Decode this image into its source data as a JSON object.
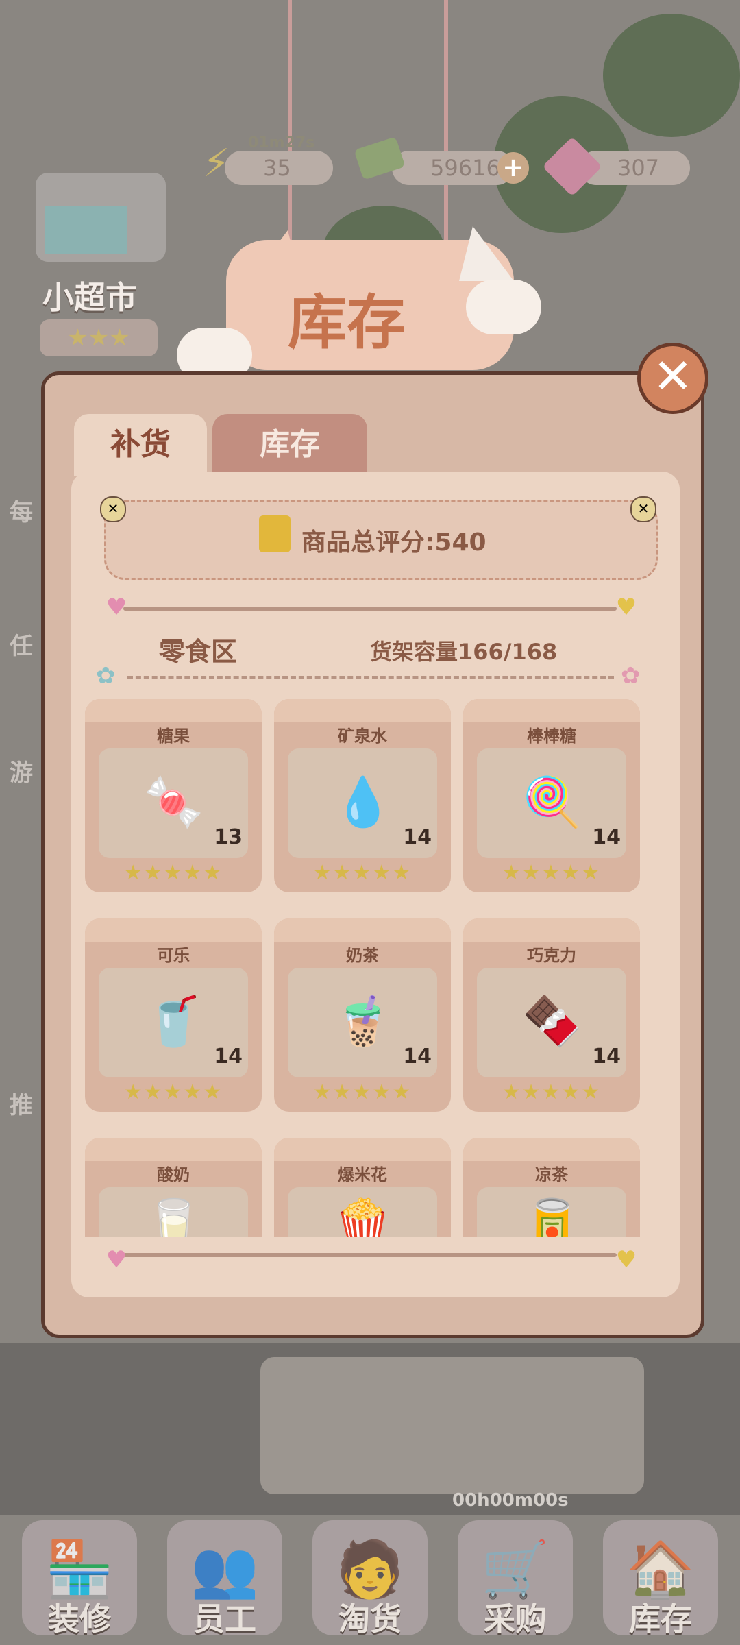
{
  "top_bar": {
    "energy_value": "35",
    "energy_timer": "01m27s",
    "cash_value": "59616",
    "gems_value": "307",
    "plus_symbol": "+"
  },
  "store": {
    "name": "小超市",
    "stars": "★★★"
  },
  "panel": {
    "title": "库存",
    "tabs": [
      {
        "label": "补货",
        "active": true
      },
      {
        "label": "库存",
        "active": false
      }
    ],
    "score_label": "商品总评分:540",
    "zone_name": "零食区",
    "shelf_capacity": "货架容量166/168",
    "close_symbol": "✕"
  },
  "items": [
    {
      "name": "糖果",
      "count": "13",
      "stars": "★★★★★",
      "icon": "candy-icon",
      "glyph": "🍬"
    },
    {
      "name": "矿泉水",
      "count": "14",
      "stars": "★★★★★",
      "icon": "water-bottle-icon",
      "glyph": "💧"
    },
    {
      "name": "棒棒糖",
      "count": "14",
      "stars": "★★★★★",
      "icon": "lollipop-icon",
      "glyph": "🍭"
    },
    {
      "name": "可乐",
      "count": "14",
      "stars": "★★★★★",
      "icon": "cola-bottle-icon",
      "glyph": "🥤"
    },
    {
      "name": "奶茶",
      "count": "14",
      "stars": "★★★★★",
      "icon": "milk-tea-icon",
      "glyph": "🧋"
    },
    {
      "name": "巧克力",
      "count": "14",
      "stars": "★★★★★",
      "icon": "chocolate-icon",
      "glyph": "🍫"
    },
    {
      "name": "酸奶",
      "count": "",
      "stars": "",
      "icon": "yogurt-icon",
      "glyph": "🥛"
    },
    {
      "name": "爆米花",
      "count": "",
      "stars": "",
      "icon": "popcorn-icon",
      "glyph": "🍿"
    },
    {
      "name": "凉茶",
      "count": "",
      "stars": "",
      "icon": "herbal-tea-can-icon",
      "glyph": "🥫"
    }
  ],
  "bottom_nav": {
    "timer": "00h00m00s",
    "items": [
      {
        "label": "装修",
        "icon": "decorate-icon",
        "glyph": "🏪"
      },
      {
        "label": "员工",
        "icon": "staff-icon",
        "glyph": "👥"
      },
      {
        "label": "淘货",
        "icon": "sourcing-icon",
        "glyph": "🧑"
      },
      {
        "label": "采购",
        "icon": "shopping-cart-icon",
        "glyph": "🛒"
      },
      {
        "label": "库存",
        "icon": "warehouse-icon",
        "glyph": "🏠"
      }
    ]
  },
  "side_hints": [
    "每",
    "任",
    "游",
    "推"
  ],
  "colors": {
    "panel_border": "#5b3a2f",
    "panel_bg": "#ecd5c4",
    "title_orange": "#c6734d",
    "star_yellow": "#d7b849",
    "close_orange": "#d2845f"
  }
}
